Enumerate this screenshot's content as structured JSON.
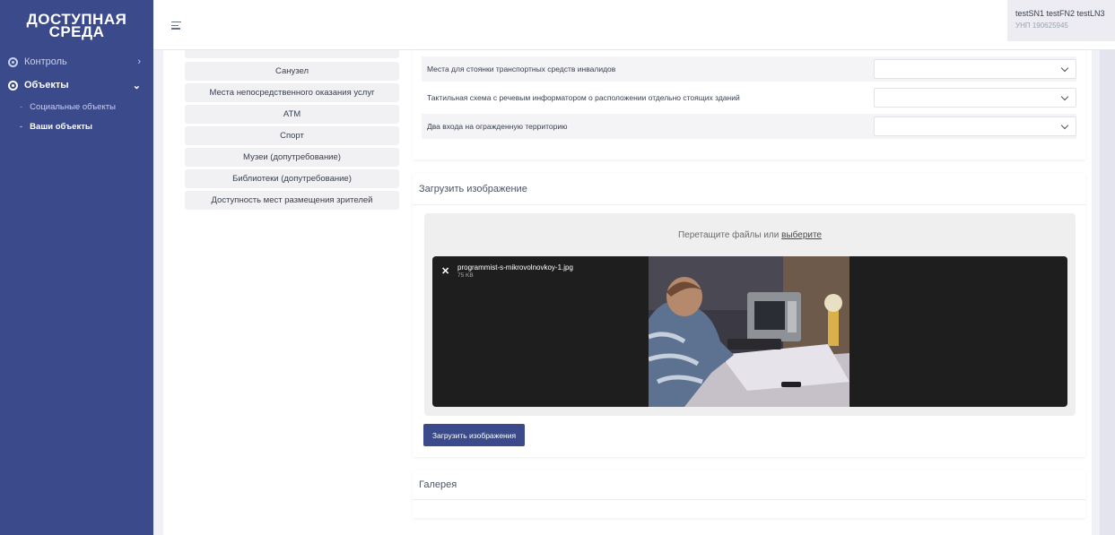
{
  "brand": {
    "line1": "ДОСТУПНАЯ",
    "line2": "СРЕДА"
  },
  "sidebar": {
    "items": [
      {
        "label": "Контроль",
        "chevron": "›"
      },
      {
        "label": "Объекты",
        "chevron": "⌄"
      }
    ],
    "subitems": [
      {
        "label": "Социальные объекты"
      },
      {
        "label": "Ваши объекты"
      }
    ]
  },
  "user": {
    "name": "testSN1 testFN2 testLN3",
    "unp": "УНП 190625945"
  },
  "categories": [
    "Санузел",
    "Места непосредственного оказания услуг",
    "АТМ",
    "Спорт",
    "Музеи (допутребование)",
    "Библиотеки (допутребование)",
    "Доступность мест размещения зрителей"
  ],
  "criteria": [
    {
      "label": "Места для стоянки транспортных средств инвалидов",
      "value": ""
    },
    {
      "label": "Тактильная схема с речевым информатором о расположении отдельно стоящих зданий",
      "value": ""
    },
    {
      "label": "Два входа на огражденную территорию",
      "value": ""
    }
  ],
  "upload": {
    "title": "Загрузить изображение",
    "drop_text": "Перетащите файлы или",
    "drop_link": "выберите",
    "file_name": "programmist-s-mikrovolnovkoy-1.jpg",
    "file_size": "75 KB",
    "button": "Загрузить изображения"
  },
  "gallery": {
    "title": "Галерея"
  },
  "colors": {
    "sidebar": "#3a4a8a",
    "button": "#3a4a8a",
    "content_bg": "#f0f1f6"
  }
}
